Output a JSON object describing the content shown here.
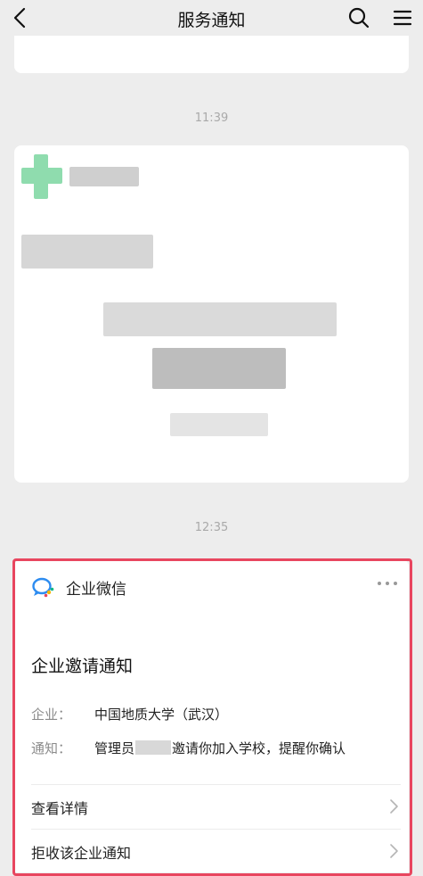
{
  "header": {
    "title": "服务通知"
  },
  "timestamps": {
    "first": "11:39",
    "second": "12:35"
  },
  "notice": {
    "brand": "企业微信",
    "title": "企业邀请通知",
    "rows": [
      {
        "label": "企业：",
        "value": "中国地质大学（武汉）"
      },
      {
        "label": "通知：",
        "value_before": "管理员",
        "value_after": "邀请你加入学校，提醒你确认"
      }
    ],
    "actions": [
      {
        "label": "查看详情"
      },
      {
        "label": "拒收该企业通知"
      }
    ]
  },
  "colors": {
    "highlight": "#e8465f",
    "background": "#ededed"
  }
}
